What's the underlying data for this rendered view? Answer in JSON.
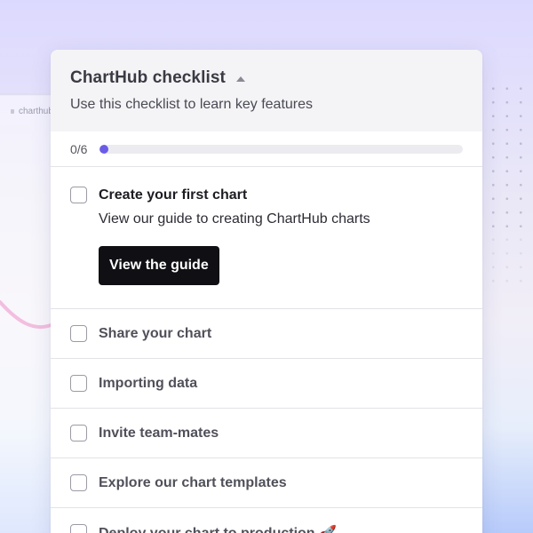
{
  "background": {
    "url_text": "charthub."
  },
  "checklist": {
    "title": "ChartHub checklist",
    "subtitle": "Use this checklist to learn key features",
    "progress": {
      "label": "0/6",
      "completed": 0,
      "total": 6
    },
    "items": [
      {
        "title": "Create your first chart",
        "description": "View our guide to creating ChartHub charts",
        "button_label": "View the guide",
        "checked": false,
        "expanded": true
      },
      {
        "title": "Share your chart",
        "checked": false
      },
      {
        "title": "Importing data",
        "checked": false
      },
      {
        "title": "Invite team-mates",
        "checked": false
      },
      {
        "title": "Explore our chart templates",
        "checked": false
      },
      {
        "title": "Deploy your chart to production 🚀",
        "checked": false
      }
    ]
  },
  "colors": {
    "accent": "#6b5ce7",
    "button_bg": "#0f0f14",
    "header_bg": "#f4f4f6"
  }
}
